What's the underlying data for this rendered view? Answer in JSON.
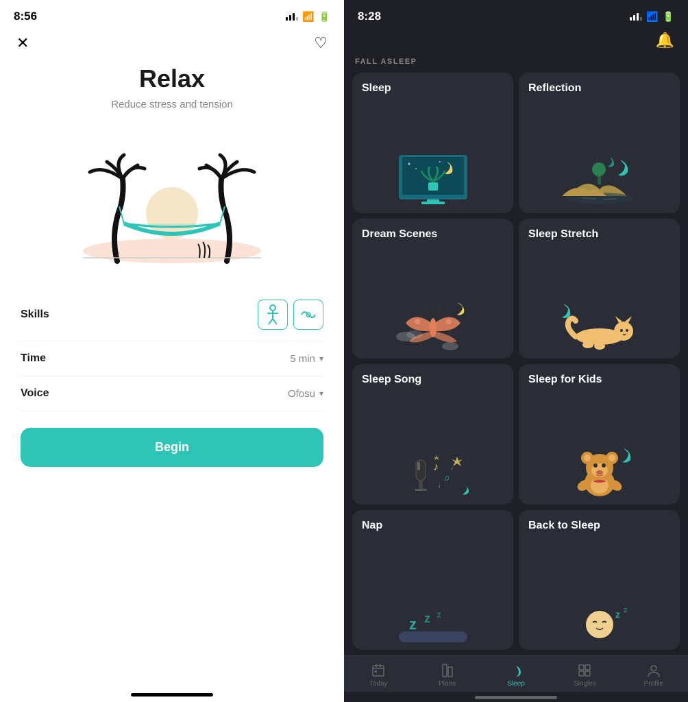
{
  "left": {
    "statusBar": {
      "time": "8:56"
    },
    "nav": {
      "closeLabel": "✕",
      "heartLabel": "♡"
    },
    "content": {
      "title": "Relax",
      "subtitle": "Reduce stress and tension",
      "detailRows": [
        {
          "label": "Skills",
          "type": "icons"
        },
        {
          "label": "Time",
          "value": "5 min",
          "hasChevron": true
        },
        {
          "label": "Voice",
          "value": "Ofosu",
          "hasChevron": true
        }
      ],
      "beginButton": "Begin"
    }
  },
  "right": {
    "statusBar": {
      "time": "8:28"
    },
    "header": {
      "bellIcon": "🔔"
    },
    "sectionLabel": "FALL ASLEEP",
    "grid": [
      {
        "id": "sleep",
        "title": "Sleep",
        "emoji": "🌙"
      },
      {
        "id": "reflection",
        "title": "Reflection",
        "emoji": "🌄"
      },
      {
        "id": "dream-scenes",
        "title": "Dream Scenes",
        "emoji": "🦋"
      },
      {
        "id": "sleep-stretch",
        "title": "Sleep Stretch",
        "emoji": "🌙"
      },
      {
        "id": "sleep-song",
        "title": "Sleep Song",
        "emoji": "🎵"
      },
      {
        "id": "sleep-for-kids",
        "title": "Sleep for Kids",
        "emoji": "🧸"
      },
      {
        "id": "nap",
        "title": "Nap",
        "emoji": "💤"
      },
      {
        "id": "back-to-sleep",
        "title": "Back to Sleep",
        "emoji": "😴"
      }
    ],
    "tabBar": {
      "tabs": [
        {
          "id": "today",
          "label": "Today",
          "icon": "📅",
          "active": false
        },
        {
          "id": "plans",
          "label": "Plans",
          "icon": "📋",
          "active": false
        },
        {
          "id": "sleep",
          "label": "Sleep",
          "icon": "🌙",
          "active": true
        },
        {
          "id": "singles",
          "label": "Singles",
          "icon": "▦",
          "active": false
        },
        {
          "id": "profile",
          "label": "Profile",
          "icon": "👤",
          "active": false
        }
      ]
    }
  }
}
